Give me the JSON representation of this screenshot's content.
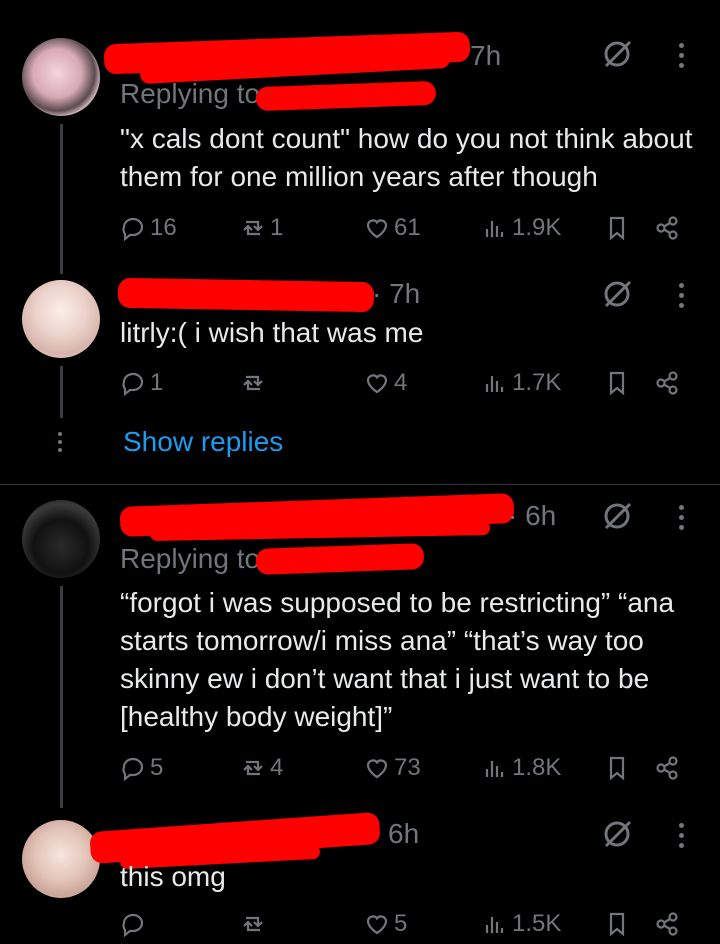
{
  "posts": [
    {
      "time_label": "7h",
      "replying_prefix": "Replying to",
      "text": "\"x cals dont count\" how do you not think about them for one million years after though",
      "counts": {
        "replies": "16",
        "reposts": "1",
        "likes": "61",
        "views": "1.9K"
      }
    },
    {
      "time_label": "· 7h",
      "text": "litrly:( i wish that was me",
      "counts": {
        "replies": "1",
        "reposts": "",
        "likes": "4",
        "views": "1.7K"
      }
    },
    {
      "time_label": "· 6h",
      "replying_prefix": "Replying to",
      "text": "“forgot i was supposed to be restricting” “ana starts tomorrow/i miss ana” “that’s way too skinny ew i don’t want that i just want to be [healthy body weight]”",
      "counts": {
        "replies": "5",
        "reposts": "4",
        "likes": "73",
        "views": "1.8K"
      }
    },
    {
      "time_label": "6h",
      "text": "this omg",
      "counts": {
        "replies": "",
        "reposts": "",
        "likes": "5",
        "views": "1.5K"
      }
    }
  ],
  "show_replies_label": "Show replies",
  "colors": {
    "background": "#000000",
    "text": "#e7e9ea",
    "muted": "#71767b",
    "link": "#1d9bf0",
    "redaction": "#ff0000"
  },
  "icons": [
    "reply-icon",
    "repost-icon",
    "like-icon",
    "views-icon",
    "bookmark-icon",
    "share-icon",
    "grok-icon",
    "more-icon"
  ]
}
